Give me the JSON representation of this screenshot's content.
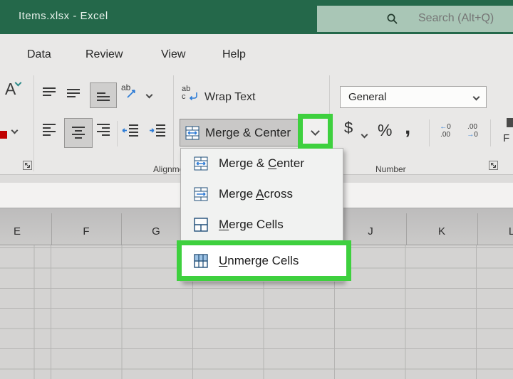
{
  "titlebar": {
    "title": "Items.xlsx  -  Excel",
    "search_placeholder": "Search (Alt+Q)"
  },
  "tabs": [
    {
      "label": "Data"
    },
    {
      "label": "Review"
    },
    {
      "label": "View"
    },
    {
      "label": "Help"
    }
  ],
  "ribbon": {
    "font_button_letter": "A",
    "wrap_text_label": "Wrap Text",
    "merge_center_label": "Merge & Center",
    "alignment_group_label": "Alignment",
    "number_group_label": "Number",
    "number_format_value": "General",
    "currency_label": "$",
    "percent_label": "%",
    "comma_label": ",",
    "increase_decimal_icon": {
      "top_arrow": "←",
      "top_text": "0",
      "bottom_text": ".00"
    },
    "decrease_decimal_icon": {
      "top_text": ".00",
      "bottom_arrow": "→",
      "bottom_text": "0"
    },
    "partial_right_label": "F"
  },
  "menu": {
    "items": [
      {
        "pre": "Merge & ",
        "u": "C",
        "post": "enter"
      },
      {
        "pre": "Merge ",
        "u": "A",
        "post": "cross"
      },
      {
        "pre": "",
        "u": "M",
        "post": "erge Cells"
      },
      {
        "pre": "",
        "u": "U",
        "post": "nmerge Cells"
      }
    ]
  },
  "sheet": {
    "visible_columns": [
      "E",
      "F",
      "G",
      "J",
      "K",
      "L"
    ]
  },
  "colors": {
    "title_green": "#24684a",
    "search_green": "#a9c6b6",
    "annotation_green": "#3ed03e",
    "icon_navy": "#1f4e79",
    "icon_blue": "#2e7cd6",
    "ribbon_bg": "#e9e8e7",
    "grid_bg": "#d4d3d2",
    "gridline": "#b5b4b3"
  }
}
